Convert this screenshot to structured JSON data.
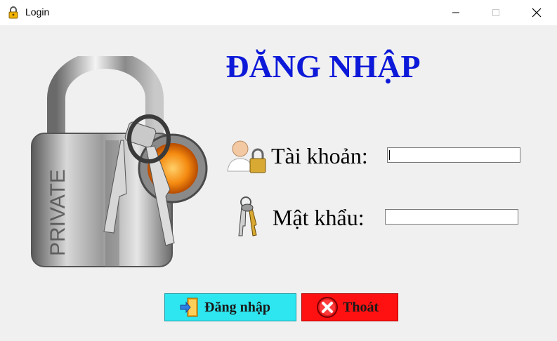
{
  "window": {
    "title": "Login",
    "controls": [
      "minimize-icon",
      "maximize-icon",
      "close-icon"
    ]
  },
  "form": {
    "heading": "ĐĂNG NHẬP",
    "username_label": "Tài khoản:",
    "username_value": "",
    "password_label": "Mật khẩu:",
    "password_value": ""
  },
  "buttons": {
    "login_label": "Đăng nhập",
    "exit_label": "Thoát"
  },
  "artwork": {
    "lock_engraving": "PRIVATE"
  },
  "colors": {
    "heading": "#0d19d8",
    "login_button": "#2ee6f0",
    "exit_button": "#ff1111"
  }
}
